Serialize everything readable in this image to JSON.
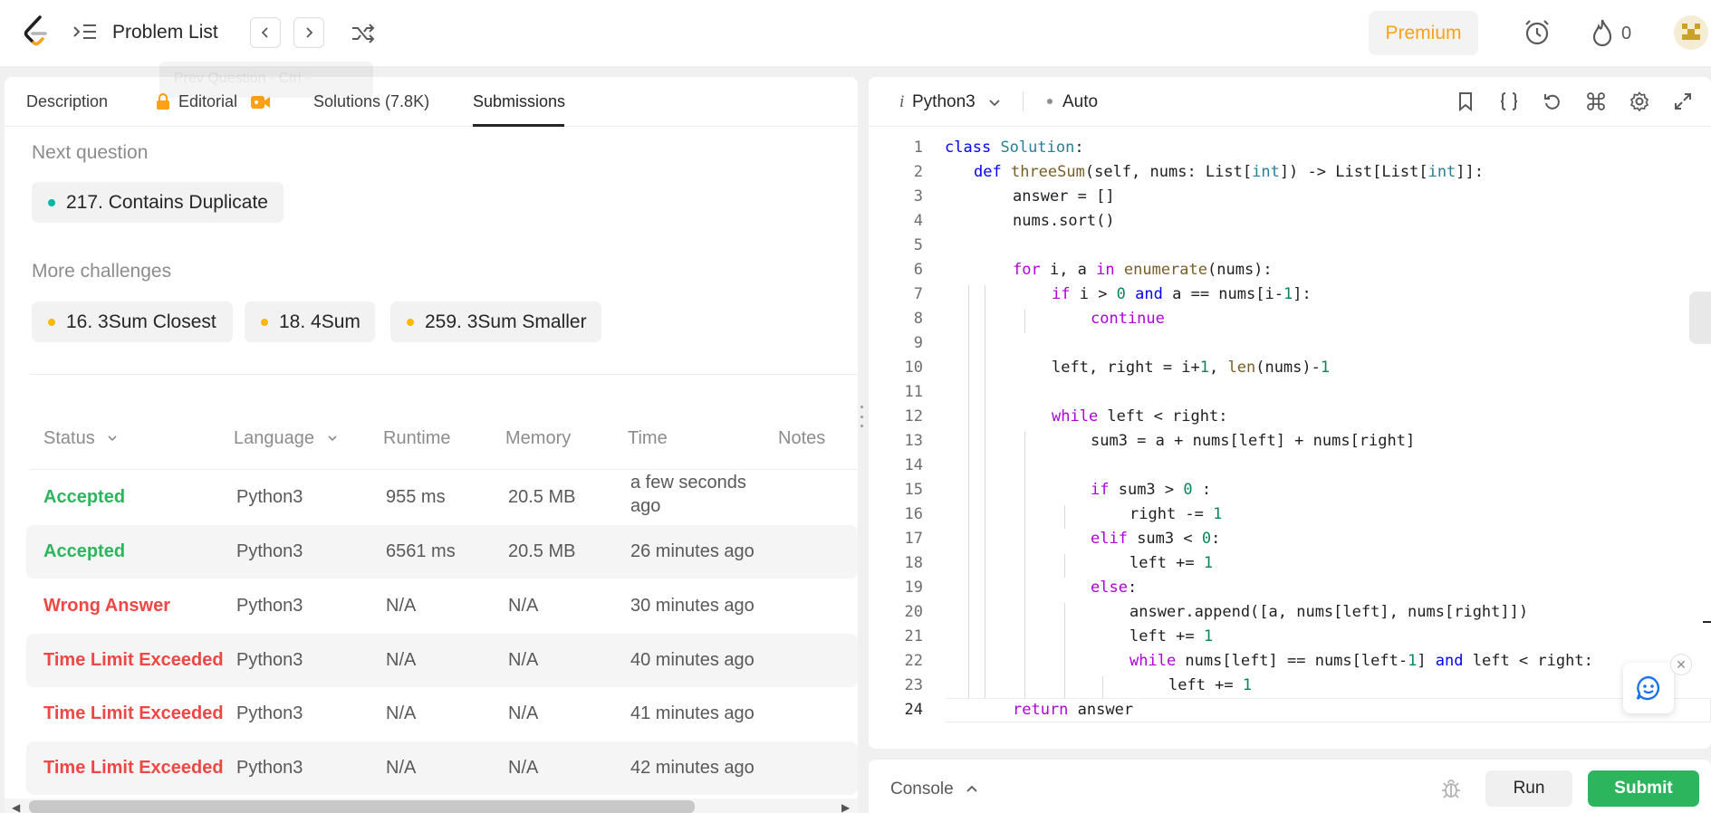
{
  "topbar": {
    "problem_list_label": "Problem List",
    "tooltip_text": "Prev Question · Ctrl ·",
    "premium_label": "Premium",
    "streak_count": "0"
  },
  "tabs": {
    "description": "Description",
    "editorial": "Editorial",
    "solutions": "Solutions (7.8K)",
    "submissions": "Submissions"
  },
  "next_question": {
    "label": "Next question",
    "item": "217. Contains Duplicate",
    "dot_color": "#00b8a3"
  },
  "more_challenges": {
    "label": "More challenges",
    "items": [
      "16. 3Sum Closest",
      "18. 4Sum",
      "259. 3Sum Smaller"
    ],
    "dot_color": "#ffb800"
  },
  "submissions_table": {
    "headers": {
      "status": "Status",
      "language": "Language",
      "runtime": "Runtime",
      "memory": "Memory",
      "time": "Time",
      "notes": "Notes"
    },
    "rows": [
      {
        "status": "Accepted",
        "language": "Python3",
        "runtime": "955 ms",
        "memory": "20.5 MB",
        "time_line1": "a few seconds",
        "time_line2": "ago"
      },
      {
        "status": "Accepted",
        "language": "Python3",
        "runtime": "6561 ms",
        "memory": "20.5 MB",
        "time": "26 minutes ago"
      },
      {
        "status": "Wrong Answer",
        "language": "Python3",
        "runtime": "N/A",
        "memory": "N/A",
        "time": "30 minutes ago"
      },
      {
        "status": "Time Limit Exceeded",
        "language": "Python3",
        "runtime": "N/A",
        "memory": "N/A",
        "time": "40 minutes ago"
      },
      {
        "status": "Time Limit Exceeded",
        "language": "Python3",
        "runtime": "N/A",
        "memory": "N/A",
        "time": "41 minutes ago"
      },
      {
        "status": "Time Limit Exceeded",
        "language": "Python3",
        "runtime": "N/A",
        "memory": "N/A",
        "time": "42 minutes ago"
      }
    ],
    "colors": {
      "accepted": "#2db55d",
      "error": "#ef4743"
    }
  },
  "editor": {
    "language_icon": "i",
    "language": "Python3",
    "mode": "Auto",
    "line_numbers": [
      "1",
      "2",
      "3",
      "4",
      "5",
      "6",
      "7",
      "8",
      "9",
      "10",
      "11",
      "12",
      "13",
      "14",
      "15",
      "16",
      "17",
      "18",
      "19",
      "20",
      "21",
      "22",
      "23",
      "24"
    ],
    "code_lines": [
      "class Solution:",
      "    def threeSum(self, nums: List[int]) -> List[List[int]]:",
      "        answer = []",
      "        nums.sort()",
      "",
      "        for i, a in enumerate(nums):",
      "            if i > 0 and a == nums[i-1]:",
      "                continue",
      "",
      "            left, right = i+1, len(nums)-1",
      "",
      "            while left < right:",
      "                sum3 = a + nums[left] + nums[right]",
      "",
      "                if sum3 > 0 :",
      "                    right -= 1",
      "                elif sum3 < 0:",
      "                    left += 1",
      "                else:",
      "                    answer.append([a, nums[left], nums[right]])",
      "                    left += 1",
      "                    while nums[left] == nums[left-1] and left < right:",
      "                        left += 1",
      "        return answer"
    ]
  },
  "console": {
    "label": "Console",
    "run_label": "Run",
    "submit_label": "Submit"
  },
  "icons": {
    "logo": "leetcode-logo-icon",
    "problem_list": "list-indent-icon",
    "prev": "chevron-left-icon",
    "next": "chevron-right-icon",
    "shuffle": "shuffle-icon",
    "alarm": "alarm-clock-icon",
    "fire": "fire-icon",
    "bookmark": "bookmark-icon",
    "braces": "braces-icon",
    "reset": "reset-icon",
    "shortcuts": "command-key-icon",
    "settings": "gear-icon",
    "fullscreen": "expand-icon",
    "bug": "bug-icon",
    "chat": "chat-bot-icon"
  },
  "colors": {
    "brand_orange": "#ffa116",
    "submit_green": "#2db55d"
  }
}
